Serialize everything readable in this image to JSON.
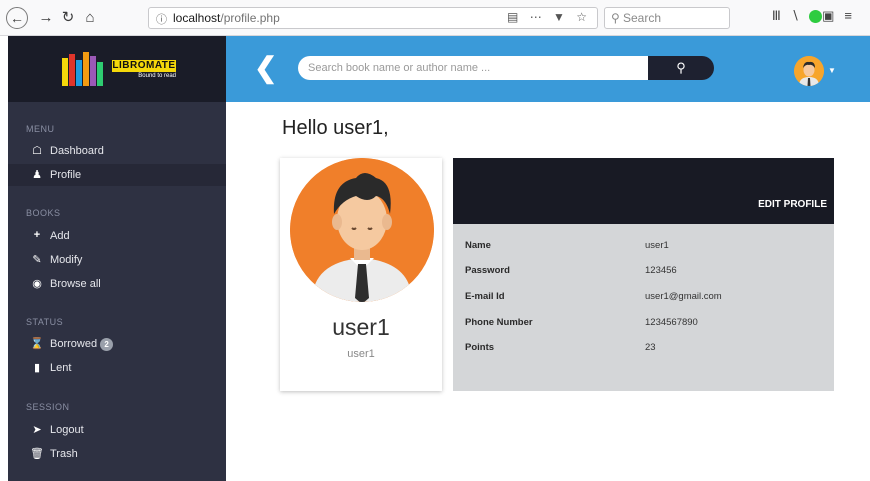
{
  "browser": {
    "url_host": "localhost",
    "url_path": "/profile.php",
    "search_placeholder": "Search"
  },
  "brand": {
    "name": "LIBROMATE",
    "tagline": "Bound to read"
  },
  "header": {
    "search_placeholder": "Search book name or author name ..."
  },
  "sidebar": {
    "sections": [
      {
        "title": "MENU"
      },
      {
        "title": "BOOKS"
      },
      {
        "title": "STATUS"
      },
      {
        "title": "SESSION"
      }
    ],
    "items": [
      {
        "label": "Dashboard",
        "icon": "home-icon"
      },
      {
        "label": "Profile",
        "icon": "user-icon"
      },
      {
        "label": "Add",
        "icon": "plus-icon"
      },
      {
        "label": "Modify",
        "icon": "edit-icon"
      },
      {
        "label": "Browse all",
        "icon": "eye-icon"
      },
      {
        "label": "Borrowed",
        "icon": "hourglass-icon",
        "badge": "2"
      },
      {
        "label": "Lent",
        "icon": "book-icon"
      },
      {
        "label": "Logout",
        "icon": "logout-icon"
      },
      {
        "label": "Trash",
        "icon": "trash-icon"
      }
    ]
  },
  "main": {
    "greeting": "Hello user1,",
    "profile_card": {
      "name": "user1",
      "username": "user1"
    },
    "edit_label": "EDIT PROFILE",
    "fields": [
      {
        "label": "Name",
        "value": "user1"
      },
      {
        "label": "Password",
        "value": "123456"
      },
      {
        "label": "E-mail Id",
        "value": "user1@gmail.com"
      },
      {
        "label": "Phone Number",
        "value": "1234567890"
      },
      {
        "label": "Points",
        "value": "23"
      }
    ]
  },
  "colors": {
    "header": "#3a9ad9",
    "sidebar": "#2e3142",
    "brand_accent": "#f5d80a",
    "avatar_bg": "#f07f2a"
  }
}
